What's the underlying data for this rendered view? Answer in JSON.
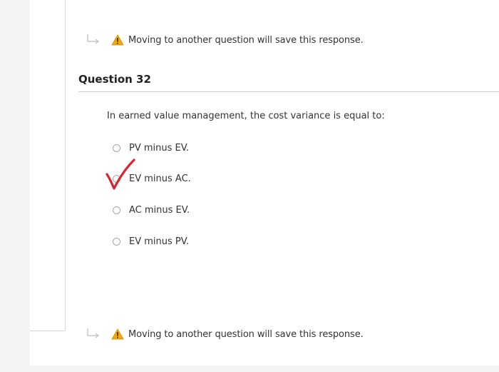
{
  "save_notice_top": "Moving to another question will save this response.",
  "question": {
    "title": "Question 32",
    "text": "In earned value management, the cost variance is equal to:",
    "options": [
      {
        "label": "PV minus EV."
      },
      {
        "label": "EV minus AC."
      },
      {
        "label": "AC minus EV."
      },
      {
        "label": "EV minus PV."
      }
    ],
    "marked_option_index": 1
  },
  "save_notice_bottom": "Moving to another question will save this response.",
  "colors": {
    "check_mark": "#d9232e",
    "warning_fill": "#f2a900",
    "gutter": "#f4f4f4"
  },
  "icons": {
    "arrow": "return-arrow-icon",
    "warning": "warning-icon",
    "check": "red-check-mark-icon"
  }
}
